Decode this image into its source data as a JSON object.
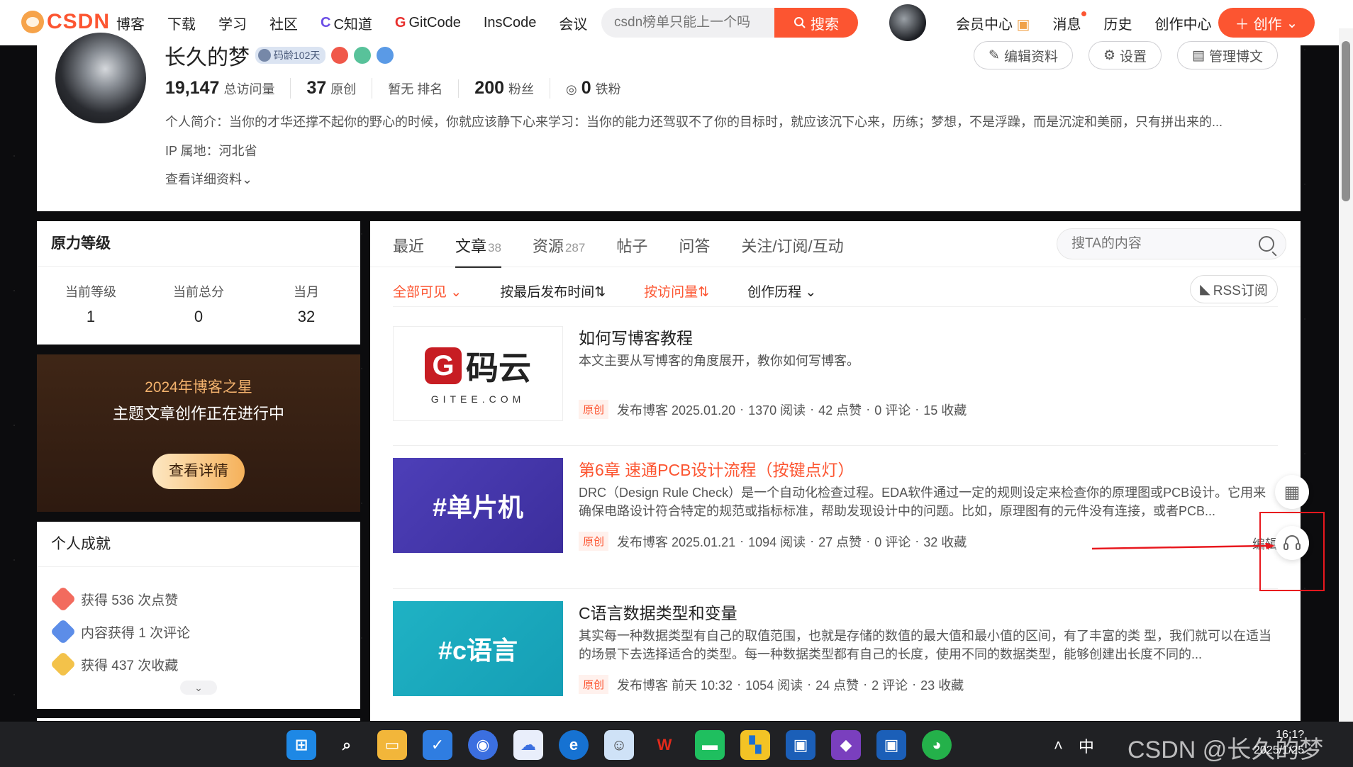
{
  "nav": {
    "logo": "CSDN",
    "items": [
      "博客",
      "下载",
      "学习",
      "社区",
      "C知道",
      "GitCode",
      "InsCode",
      "会议"
    ],
    "search_placeholder": "csdn榜单只能上一个吗",
    "search_button": "搜索",
    "right_items": [
      "会员中心",
      "消息",
      "历史",
      "创作中心"
    ],
    "create_button": "创作"
  },
  "profile": {
    "name": "长久的梦",
    "code_age": "码龄102天",
    "buttons": [
      "编辑资料",
      "设置",
      "管理博文"
    ],
    "stats": [
      {
        "num": "19,147",
        "label": "总访问量"
      },
      {
        "num": "37",
        "label": "原创"
      },
      {
        "num": "",
        "label": "暂无 排名"
      },
      {
        "num": "200",
        "label": "粉丝"
      },
      {
        "num": "0",
        "label": "铁粉"
      }
    ],
    "bio": "个人简介：当你的才华还撑不起你的野心的时候，你就应该静下心来学习：当你的能力还驾驭不了你的目标时，就应该沉下心来，历练；梦想，不是浮躁，而是沉淀和美丽，只有拼出来的...",
    "ip": "IP 属地：河北省",
    "more": "查看详细资料"
  },
  "level": {
    "title": "原力等级",
    "cols": [
      {
        "label": "当前等级",
        "value": "1"
      },
      {
        "label": "当前总分",
        "value": "0"
      },
      {
        "label": "当月",
        "value": "32"
      }
    ]
  },
  "promo": {
    "line1": "2024年博客之星",
    "line2": "主题文章创作正在进行中",
    "button": "查看详情"
  },
  "achievements": {
    "title": "个人成就",
    "items": [
      "获得 536 次点赞",
      "内容获得 1 次评论",
      "获得 437 次收藏"
    ]
  },
  "main": {
    "tabs": [
      {
        "label": "最近",
        "count": ""
      },
      {
        "label": "文章",
        "count": "38"
      },
      {
        "label": "资源",
        "count": "287"
      },
      {
        "label": "帖子",
        "count": ""
      },
      {
        "label": "问答",
        "count": ""
      },
      {
        "label": "关注/订阅/互动",
        "count": ""
      }
    ],
    "search_placeholder": "搜TA的内容",
    "filters": [
      "全部可见",
      "按最后发布时间⇅",
      "按访问量⇅",
      "创作历程"
    ],
    "rss": "RSS订阅",
    "tag_original": "原创",
    "edit": "编辑",
    "articles": [
      {
        "thumb_text": "码云",
        "thumb_sub": "GITEE.COM",
        "title": "如何写博客教程",
        "desc": "本文主要从写博客的角度展开，教你如何写博客。",
        "published": "发布博客 2025.01.20",
        "reads": "1370 阅读",
        "likes": "42 点赞",
        "comments": "0 评论",
        "favs": "15 收藏"
      },
      {
        "thumb_text": "#单片机",
        "title": "第6章 速通PCB设计流程（按键点灯）",
        "desc": "DRC（Design Rule Check）是一个自动化检查过程。EDA软件通过一定的规则设定来检查你的原理图或PCB设计。它用来确保电路设计符合特定的规范或指标标准，帮助发现设计中的问题。比如，原理图有的元件没有连接，或者PCB...",
        "published": "发布博客 2025.01.21",
        "reads": "1094 阅读",
        "likes": "27 点赞",
        "comments": "0 评论",
        "favs": "32 收藏"
      },
      {
        "thumb_text": "#c语言",
        "title": "C语言数据类型和变量",
        "desc": "其实每一种数据类型有自己的取值范围，也就是存储的数值的最大值和最小值的区间，有了丰富的类 型，我们就可以在适当的场景下去选择适合的类型。每一种数据类型都有自己的长度，使用不同的数据类型，能够创建出长度不同的...",
        "published": "发布博客 前天 10:32",
        "reads": "1054 阅读",
        "likes": "24 点赞",
        "comments": "2 评论",
        "favs": "23 收藏"
      }
    ]
  },
  "taskbar": {
    "ime": "中",
    "watermark": "CSDN @长久的梦",
    "time": "16:1?",
    "date": "2025/1/25"
  },
  "colors": {
    "accent": "#fc5531",
    "card": "#ffffff",
    "background": "#0c0c0e"
  }
}
